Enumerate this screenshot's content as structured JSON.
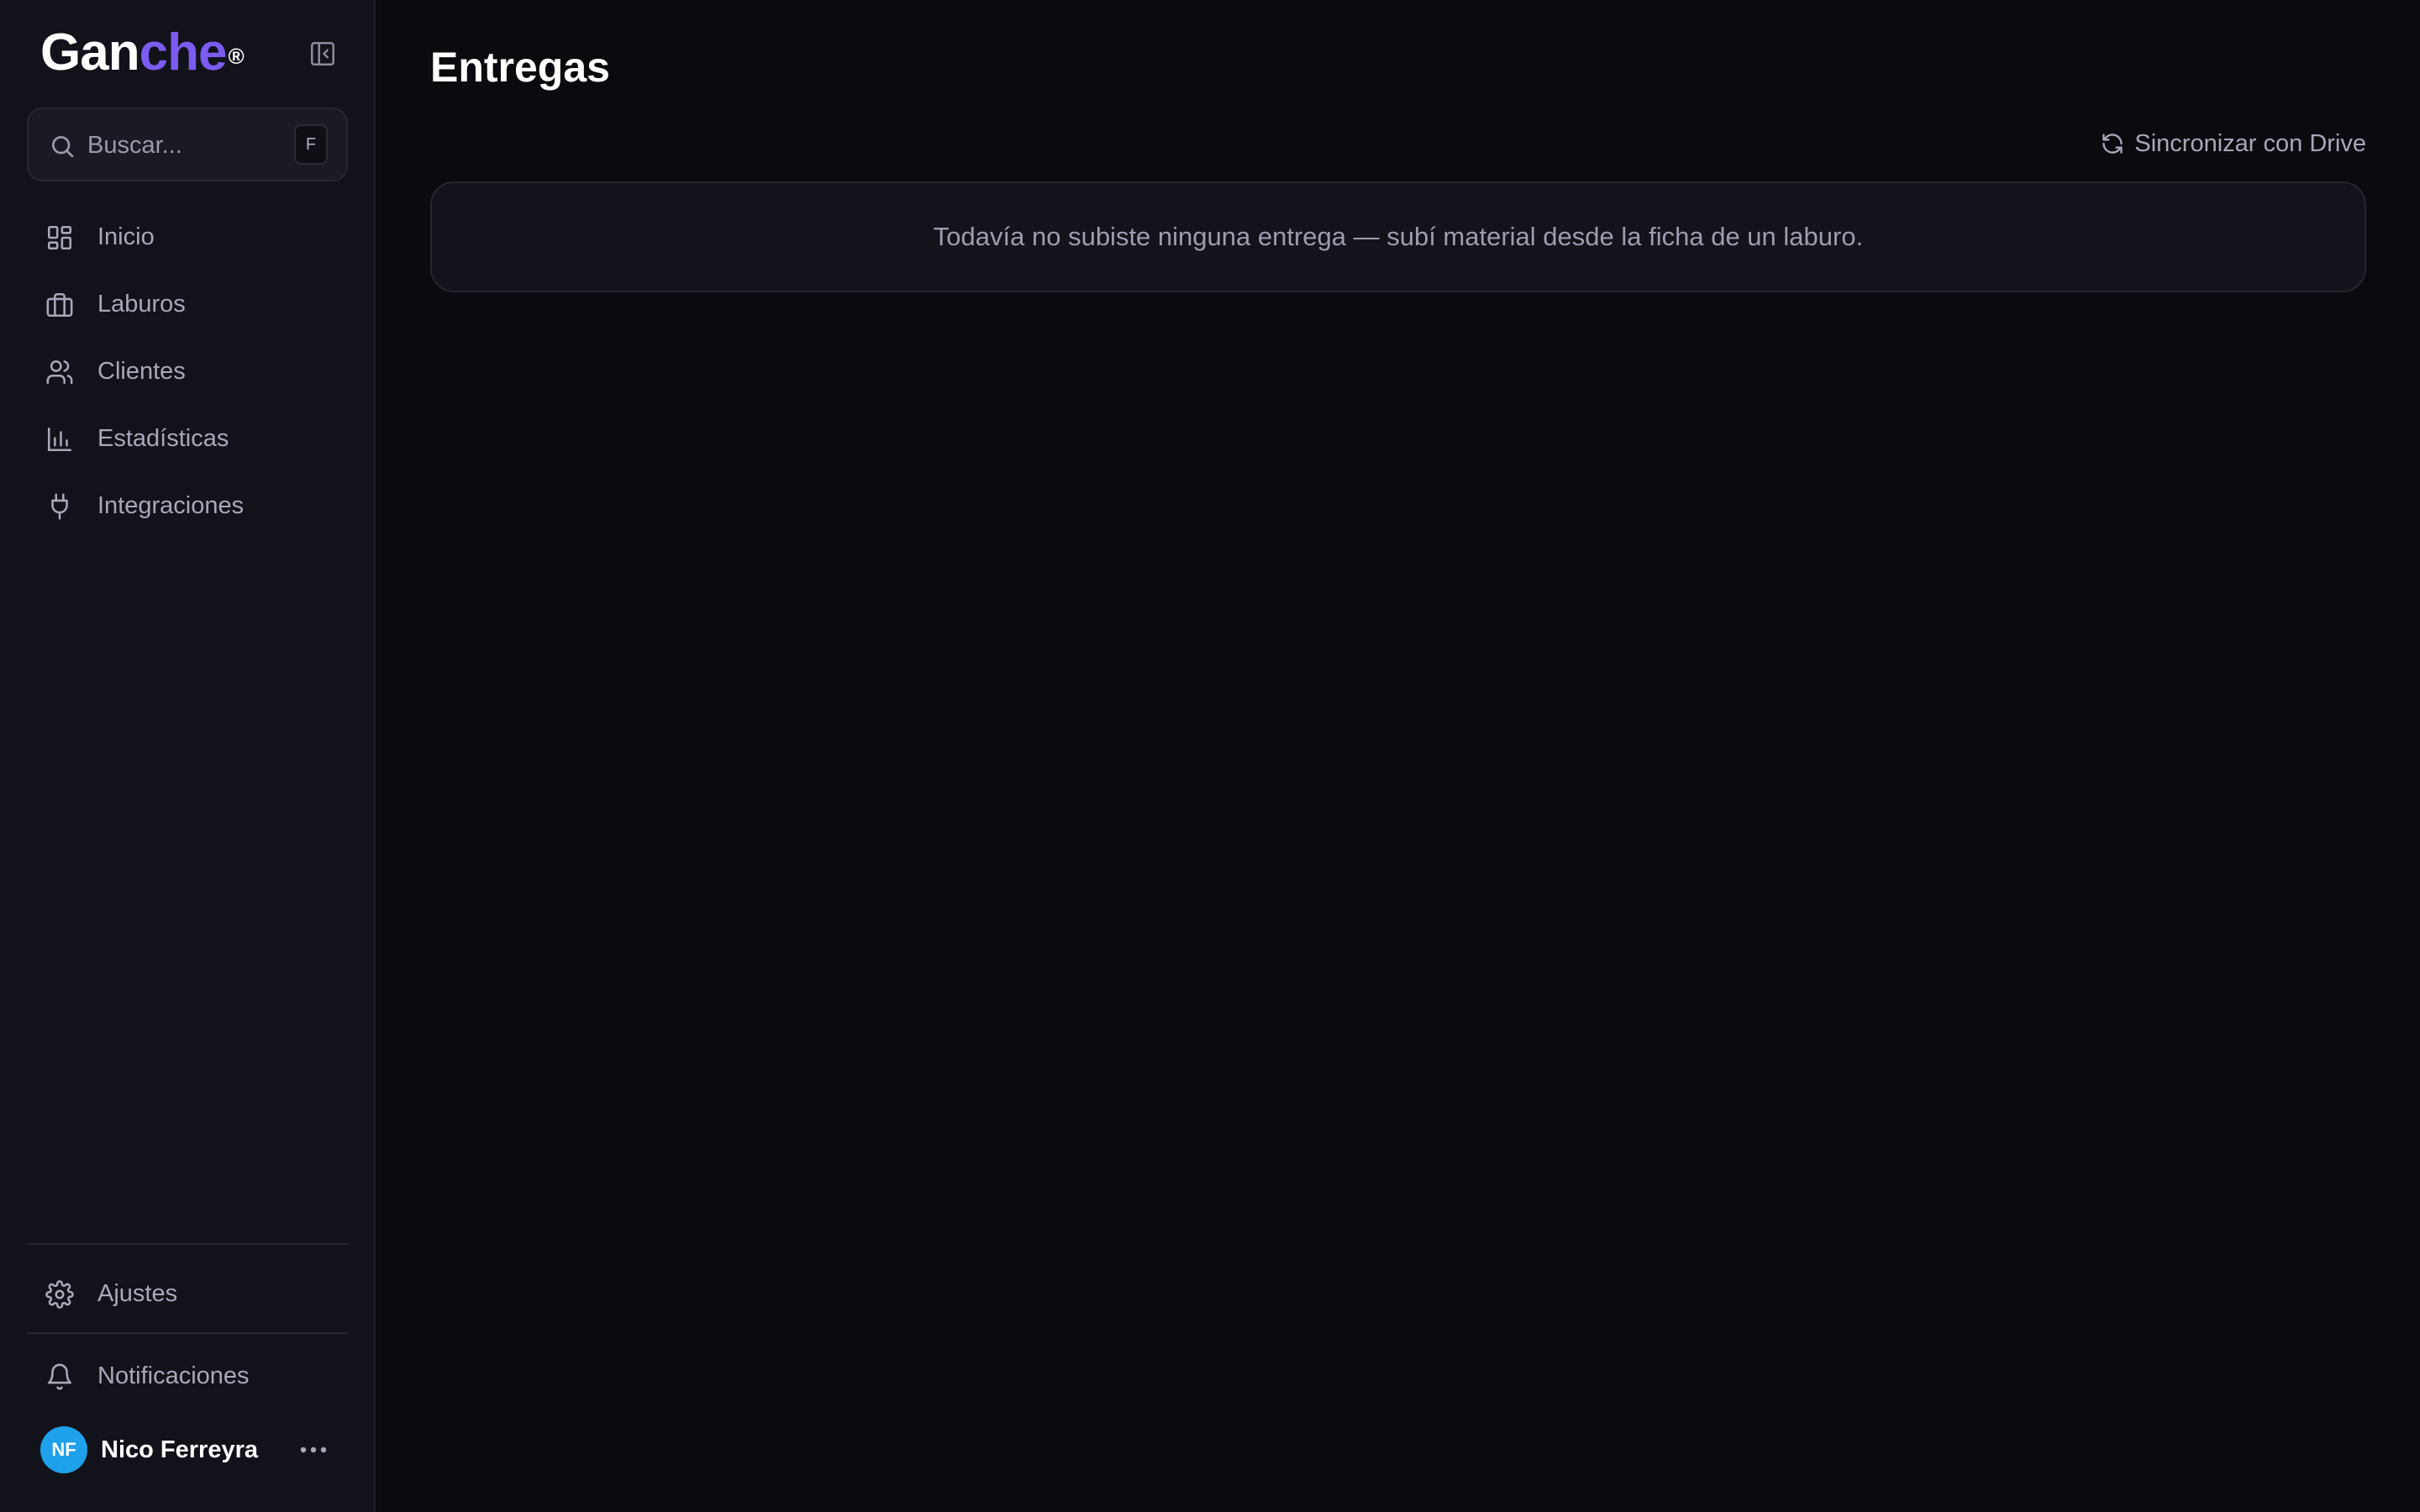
{
  "brand": {
    "name_main": "Gan",
    "name_accent": "che",
    "mark": "®",
    "accent_color": "#7c5cf0"
  },
  "search": {
    "placeholder": "Buscar...",
    "shortcut": "F"
  },
  "sidebar": {
    "items": [
      {
        "label": "Inicio",
        "icon": "dashboard-icon"
      },
      {
        "label": "Laburos",
        "icon": "briefcase-icon"
      },
      {
        "label": "Clientes",
        "icon": "users-icon"
      },
      {
        "label": "Estadísticas",
        "icon": "bar-chart-icon"
      },
      {
        "label": "Integraciones",
        "icon": "plug-icon"
      }
    ],
    "settings": {
      "label": "Ajustes",
      "icon": "gear-icon"
    },
    "notifications": {
      "label": "Notificaciones",
      "icon": "bell-icon"
    }
  },
  "user": {
    "initials": "NF",
    "name": "Nico Ferreyra",
    "avatar_color": "#1ea1ea"
  },
  "main": {
    "title": "Entregas",
    "sync_label": "Sincronizar con Drive",
    "empty_message": "Todavía no subiste ninguna entrega — subí material desde la ficha de un laburo."
  }
}
